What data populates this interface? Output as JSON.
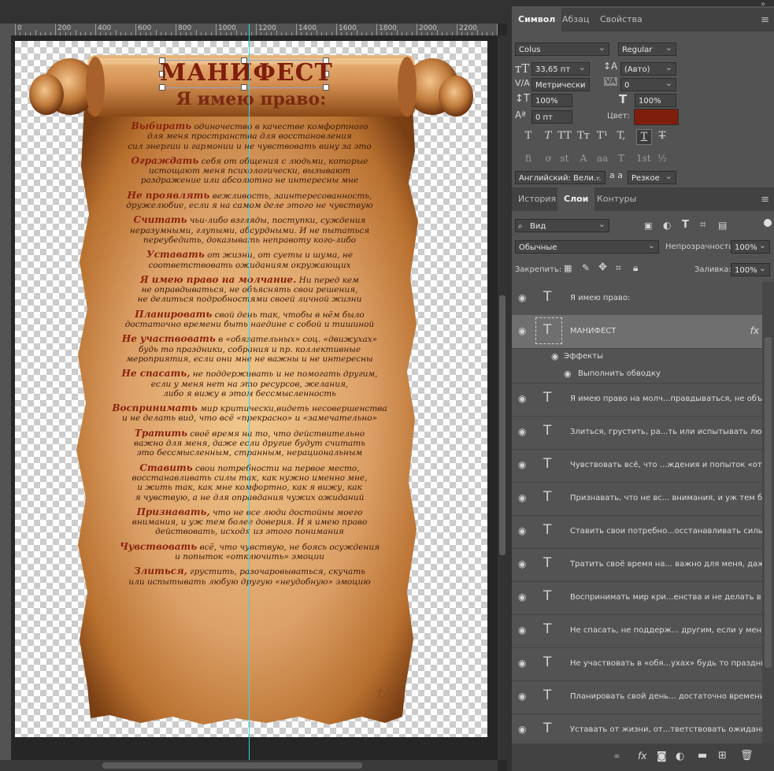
{
  "ruler": {
    "labels": [
      "0",
      "200",
      "400",
      "600",
      "800",
      "1000",
      "1200",
      "1400",
      "1600",
      "1800",
      "2000",
      "2200",
      "24"
    ]
  },
  "document": {
    "title": "МАНИФЕСТ",
    "subtitle": "Я имею право:",
    "paragraphs": [
      {
        "lead": "Выбирать",
        "lines": [
          " одиночество в качестве комфортного",
          "для меня пространства для восстановления",
          "сил энергии и гармонии и не чувствовать вину за это"
        ]
      },
      {
        "lead": "Ограждать",
        "lines": [
          " себя от общения с людьми, которые",
          "истощают меня психологически, вызывают",
          "раздражение или абсолютно не интересны мне"
        ]
      },
      {
        "lead": "Не проявлять",
        "lines": [
          " вежливость, заинтересованность,",
          "дружелюбие, если я на самом деле этого не чувствую"
        ]
      },
      {
        "lead": "Считать",
        "lines": [
          " чьи-либо взгляды, поступки, суждения",
          "неразумными, глупыми, абсурдными. И не пытаться",
          "переубедить, доказывать неправоту кого-либо"
        ]
      },
      {
        "lead": "Уставать",
        "lines": [
          " от жизни, от суеты и шума, не",
          "соответствовать ожиданиям окружающих"
        ]
      },
      {
        "lead": "Я имею право на молчание.",
        "lines": [
          " Ни перед кем",
          "не оправдываться, не объяснять свои решения,",
          "не делиться подробностями своей личной жизни"
        ]
      },
      {
        "lead": "Планировать",
        "lines": [
          " свой день так, чтобы в нём было",
          "достаточно времени быть наедине с собой и тишиной"
        ]
      },
      {
        "lead": "Не участвовать",
        "lines": [
          " в «обязательных» соц. «движухах»",
          "будь то праздники, собрания и пр. коллективные",
          "мероприятия, если они мне не важны и не интересны"
        ]
      },
      {
        "lead": "Не спасать,",
        "lines": [
          " не поддерживать и не помогать другим,",
          "если у меня нет на это ресурсов, желания,",
          "либо я вижу в этом бессмысленность"
        ]
      },
      {
        "lead": "Воспринимать",
        "lines": [
          " мир критически,видеть несовершенства",
          "и не делать вид, что всё «прекрасно» и «замечательно»"
        ]
      },
      {
        "lead": "Тратить",
        "lines": [
          " своё время на то, что действительно",
          "важно для меня, даже если другие будут считать",
          "это бессмысленным, странным, нерациональным"
        ]
      },
      {
        "lead": "Ставить",
        "lines": [
          " свои потребности на первое место,",
          "восстанавливать силы так, как нужно именно мне,",
          "и жить так, как мне комфортно, как я вижу, как",
          "я чувствую, а не для оправдания чужих ожиданий"
        ]
      },
      {
        "lead": "Признавать,",
        "lines": [
          " что не все люди достойны моего",
          "внимания, и уж тем более доверия. И я имею право",
          "действовать, исходя из этого понимания"
        ]
      },
      {
        "lead": "Чувствовать",
        "lines": [
          " всё, что чувствую, не боясь осуждения",
          "и попыток «отключить» эмоции"
        ]
      },
      {
        "lead": "Злиться,",
        "lines": [
          " грустить, разочаровываться, скучать",
          "или испытывать любую другую «неудобную» эмоцию"
        ]
      }
    ],
    "signature": "tArt"
  },
  "panel_tabs": {
    "symbol": "Символ",
    "paragraph": "Абзац",
    "properties": "Свойства"
  },
  "character": {
    "font_family": "Colus",
    "font_style": "Regular",
    "font_size": "33,65 пт",
    "leading": "(Авто)",
    "kerning": "Метрически",
    "tracking": "0",
    "vertical_scale": "100%",
    "horizontal_scale": "100%",
    "baseline_shift": "0 пт",
    "color_label": "Цвет:",
    "color": "#7f1e0c",
    "language": "Английский: Вели...",
    "aa_label": "a a",
    "antialias": "Резкое",
    "style_buttons": [
      "T",
      "T",
      "TT",
      "Tт",
      "T¹",
      "T,",
      "T",
      "T"
    ],
    "opentype_buttons": [
      "fi",
      "ơ",
      "st",
      "A",
      "aa",
      "T",
      "1st",
      "½"
    ]
  },
  "layers_tabs": {
    "history": "История",
    "layers": "Слои",
    "paths": "Контуры"
  },
  "layers_controls": {
    "filter_kind": "Вид",
    "blend_mode": "Обычные",
    "opacity_label": "Непрозрачность:",
    "opacity": "100%",
    "lock_label": "Закрепить:",
    "fill_label": "Заливка:",
    "fill": "100%"
  },
  "layers": [
    {
      "name": "Я имею право:"
    },
    {
      "name": "МАНИФЕСТ",
      "fx": "fx",
      "effects_label": "Эффекты",
      "effect": "Выполнить обводку"
    },
    {
      "name": "Я имею право на молч...правдываться, не объ"
    },
    {
      "name": "Злиться, грустить, ра...ть или испытывать люб"
    },
    {
      "name": "Чувствовать всё, что ...ждения и попыток «от"
    },
    {
      "name": "Признавать, что не вс... внимания, и уж тем б"
    },
    {
      "name": "Ставить свои потребно...осстанавливать силы"
    },
    {
      "name": "Тратить своё время на... важно для меня, даж"
    },
    {
      "name": "Воспринимать мир кри...енства и не делать в"
    },
    {
      "name": "Не спасать, не поддерж... другим, если у меня"
    },
    {
      "name": "Не участвовать в «обя...ухах» будь то праздни"
    },
    {
      "name": "Планировать свой день... достаточно времени"
    },
    {
      "name": "Уставать от жизни, от...тветствовать ожидания"
    }
  ]
}
